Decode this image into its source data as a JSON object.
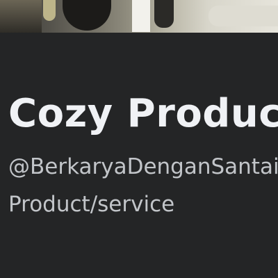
{
  "profile": {
    "name": "Cozy Product",
    "handle": "@BerkaryaDenganSantai",
    "category": "Product/service"
  }
}
